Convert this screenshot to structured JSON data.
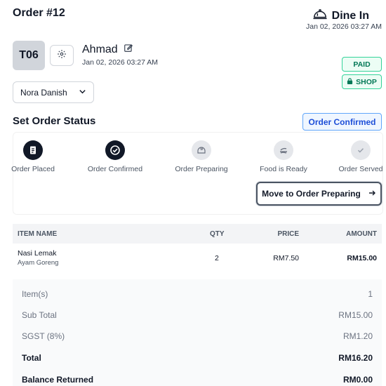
{
  "header": {
    "order_title": "Order #12",
    "order_type": "Dine In",
    "order_datetime": "Jan 02, 2026 03:27 AM"
  },
  "customer": {
    "table": "T06",
    "name": "Ahmad",
    "datetime": "Jan 02, 2026 03:27 AM"
  },
  "badges": {
    "payment": "PAID",
    "channel": "SHOP"
  },
  "staff_select": {
    "value": "Nora Danish"
  },
  "status": {
    "heading": "Set Order Status",
    "current": "Order Confirmed",
    "steps": [
      {
        "label": "Order Placed",
        "state": "done",
        "icon": "receipt-icon"
      },
      {
        "label": "Order Confirmed",
        "state": "done",
        "icon": "check-circle-icon"
      },
      {
        "label": "Order Preparing",
        "state": "pending",
        "icon": "cooking-pot-icon"
      },
      {
        "label": "Food is Ready",
        "state": "pending",
        "icon": "serving-dish-icon"
      },
      {
        "label": "Order Served",
        "state": "pending",
        "icon": "check-icon"
      }
    ],
    "move_button": "Move to Order Preparing"
  },
  "items_table": {
    "headers": {
      "name": "ITEM NAME",
      "qty": "QTY",
      "price": "PRICE",
      "amount": "AMOUNT"
    },
    "rows": [
      {
        "name": "Nasi Lemak",
        "variant": "Ayam Goreng",
        "qty": "2",
        "price": "RM7.50",
        "amount": "RM15.00"
      }
    ]
  },
  "summary": {
    "items_label": "Item(s)",
    "items_value": "1",
    "subtotal_label": "Sub Total",
    "subtotal_value": "RM15.00",
    "tax_label": "SGST (8%)",
    "tax_value": "RM1.20",
    "total_label": "Total",
    "total_value": "RM16.20",
    "balance_label": "Balance Returned",
    "balance_value": "RM0.00"
  },
  "colors": {
    "done": "#111827",
    "pending": "#e5e7eb",
    "paid_border": "#34d399",
    "status_border": "#60a5fa"
  }
}
